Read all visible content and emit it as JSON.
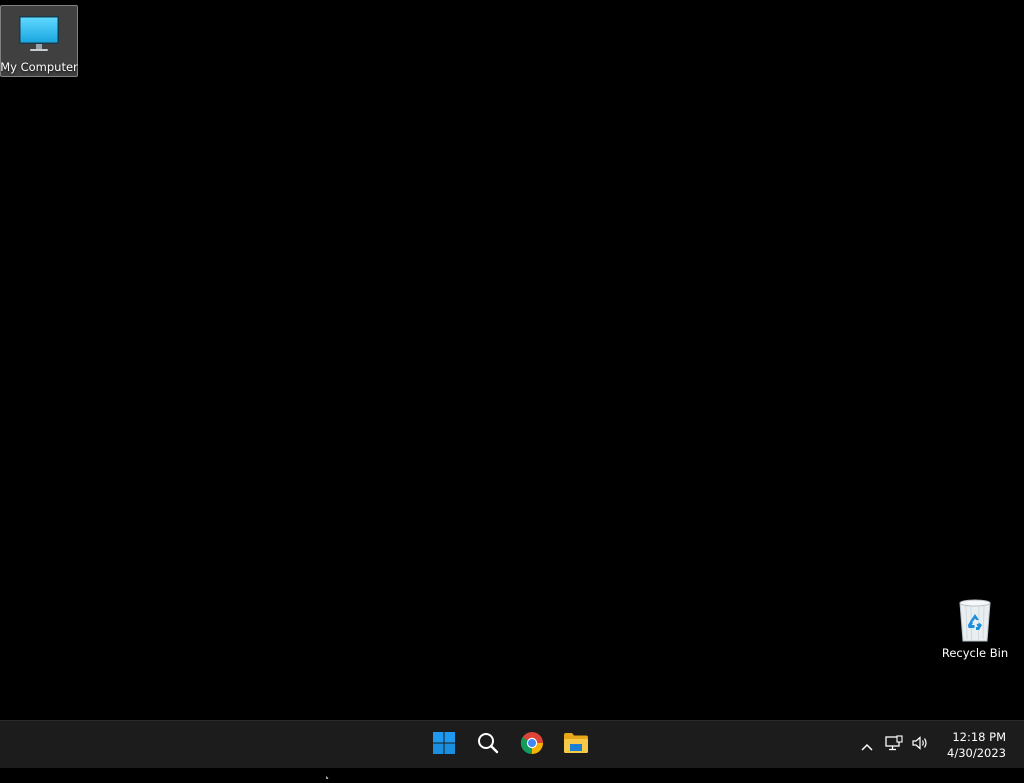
{
  "desktop": {
    "icons": [
      {
        "label": "My Computer",
        "icon": "monitor-icon",
        "selected": true
      },
      {
        "label": "Recycle Bin",
        "icon": "recycle-bin-icon",
        "selected": false
      }
    ]
  },
  "taskbar": {
    "pinned": [
      {
        "name": "start",
        "icon": "windows-logo-icon"
      },
      {
        "name": "search",
        "icon": "search-icon"
      },
      {
        "name": "chrome",
        "icon": "chrome-icon"
      },
      {
        "name": "file-explorer",
        "icon": "folder-icon"
      }
    ],
    "tray": {
      "overflow_icon": "chevron-up-icon",
      "network_icon": "network-icon",
      "volume_icon": "volume-icon"
    },
    "clock": {
      "time": "12:18 PM",
      "date": "4/30/2023"
    }
  },
  "colors": {
    "desktop_bg": "#000000",
    "taskbar_bg": "#1c1c1c",
    "windows_blue": "#0a84e0",
    "folder_yellow": "#f4c430"
  }
}
